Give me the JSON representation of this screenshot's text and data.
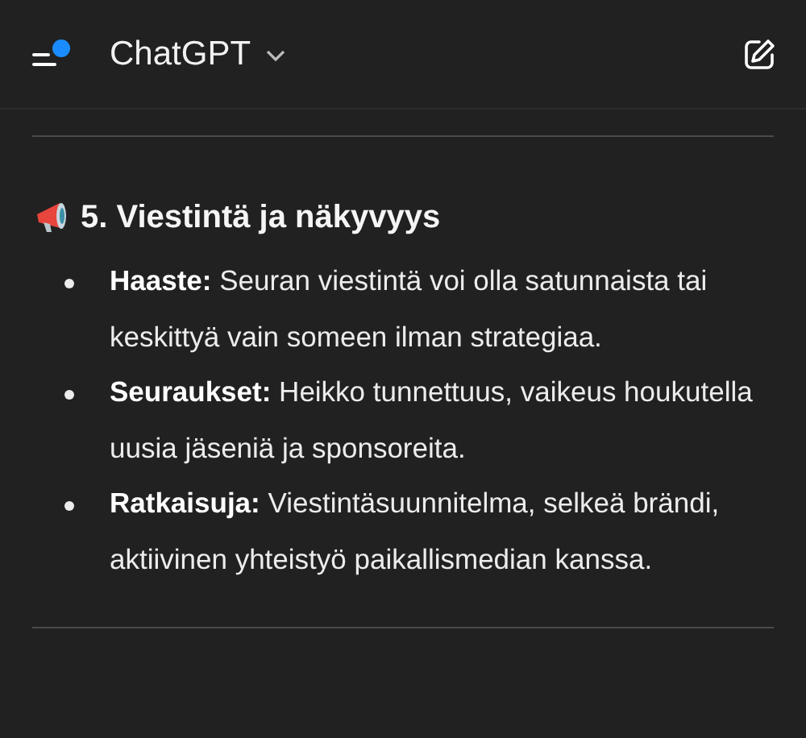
{
  "header": {
    "title": "ChatGPT",
    "notification_dot": true
  },
  "section": {
    "heading": "5. Viestintä ja näkyvyys",
    "items": [
      {
        "text": "**Haaste:** Seuran viestintä voi olla satunnaista tai keskittyä vain someen ilman strategiaa."
      },
      {
        "text": "**Seuraukset:** Heikko tunnettuus, vaikeus houkutella uusia jäseniä ja sponsoreita."
      },
      {
        "text": "**Ratkaisuja:** Viestintäsuunnitelma, selkeä brändi, aktiivinen yhteistyö paikallismedian kanssa."
      }
    ]
  }
}
